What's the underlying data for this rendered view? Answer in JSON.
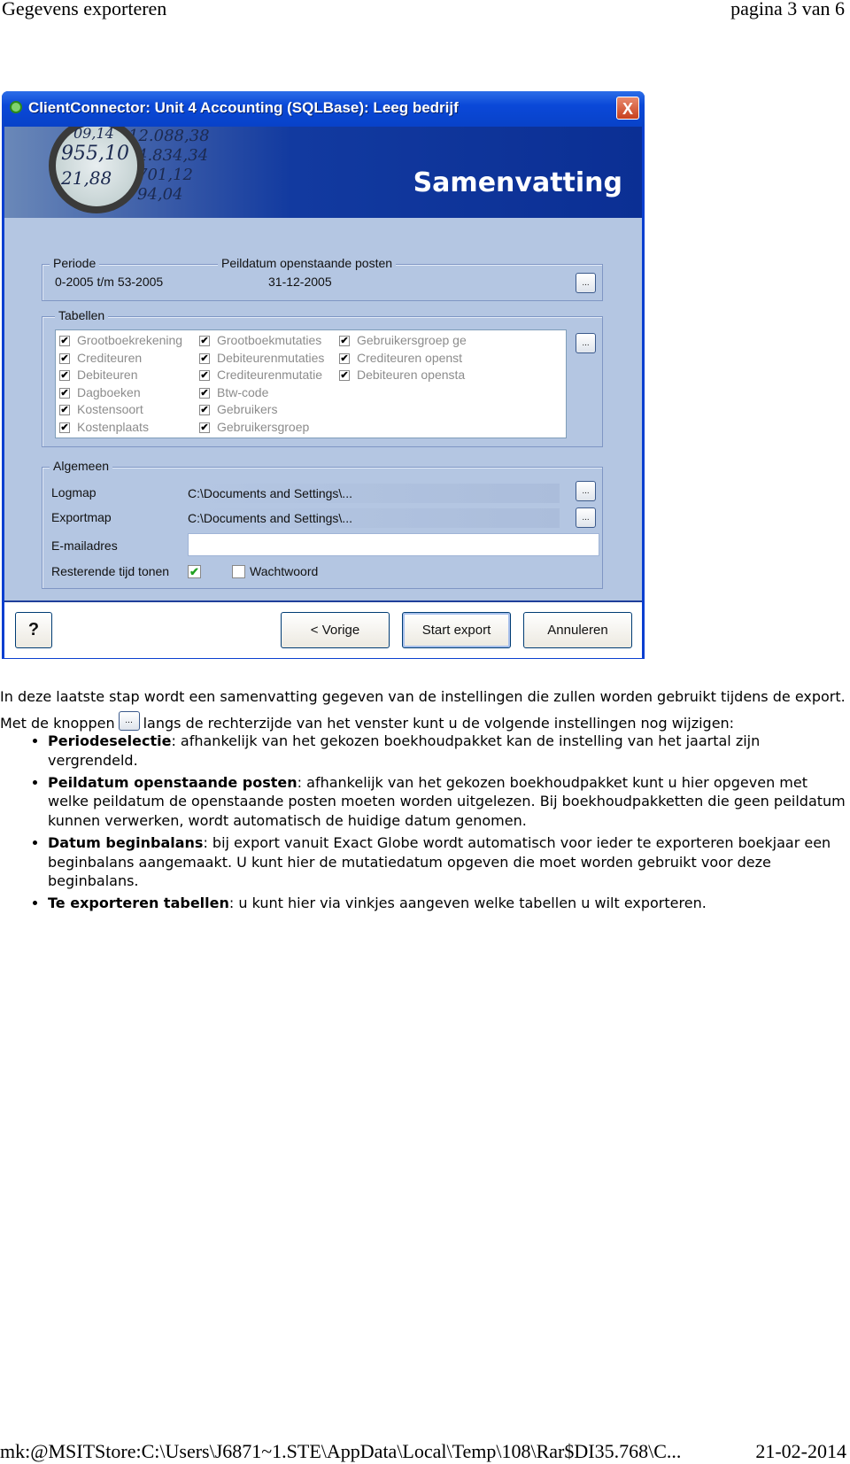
{
  "page_header": {
    "title": "Gegevens exporteren",
    "page": "pagina 3 van 6"
  },
  "window": {
    "title": "ClientConnector: Unit 4 Accounting (SQLBase): Leeg bedrijf",
    "close": "X",
    "banner_title": "Samenvatting",
    "banner_numbers": [
      "12.088,38",
      "955,10",
      "4.834,34",
      "701,12",
      "21,88",
      "94,04",
      "09,14"
    ],
    "periode_group": {
      "label": "Periode",
      "periode_value": "0-2005 t/m 53-2005",
      "peildatum_label": "Peildatum openstaande posten",
      "peildatum_value": "31-12-2005",
      "button": "..."
    },
    "tabellen_group": {
      "label": "Tabellen",
      "button": "...",
      "columns": [
        [
          "Grootboekrekening",
          "Crediteuren",
          "Debiteuren",
          "Dagboeken",
          "Kostensoort",
          "Kostenplaats"
        ],
        [
          "Grootboekmutaties",
          "Debiteurenmutaties",
          "Crediteurenmutatie",
          "Btw-code",
          "Gebruikers",
          "Gebruikersgroep"
        ],
        [
          "Gebruikersgroep ge",
          "Crediteuren openst",
          "Debiteuren opensta"
        ]
      ],
      "all_checked": true
    },
    "algemeen_group": {
      "label": "Algemeen",
      "logmap_label": "Logmap",
      "logmap_value": "C:\\Documents and Settings\\...",
      "exportmap_label": "Exportmap",
      "exportmap_value": "C:\\Documents and Settings\\...",
      "email_label": "E-mailadres",
      "email_value": "",
      "resterende_label": "Resterende tijd tonen",
      "resterende_checked": true,
      "wachtwoord_label": "Wachtwoord",
      "wachtwoord_checked": false,
      "button": "..."
    },
    "footer": {
      "help": "?",
      "prev": "< Vorige",
      "start": "Start export",
      "cancel": "Annuleren"
    }
  },
  "body": {
    "intro_before": "In deze laatste stap wordt een samenvatting gegeven van de instellingen die zullen worden gebruikt tijdens de export. Met de knoppen",
    "intro_button": "...",
    "intro_after": "langs de rechterzijde van het venster kunt u de volgende instellingen nog wijzigen:",
    "bullets": [
      {
        "term": "Periodeselectie",
        "text": ": afhankelijk van het gekozen boekhoudpakket kan de instelling van het jaartal zijn vergrendeld."
      },
      {
        "term": "Peildatum openstaande posten",
        "text": ": afhankelijk van het gekozen boekhoudpakket kunt u hier opgeven met welke peildatum de openstaande posten moeten worden uitgelezen. Bij boekhoudpakketten die geen peildatum kunnen verwerken, wordt automatisch de huidige datum genomen."
      },
      {
        "term": "Datum beginbalans",
        "text": ": bij export vanuit Exact Globe wordt automatisch voor ieder te exporteren boekjaar een beginbalans aangemaakt. U kunt hier de mutatiedatum opgeven die moet worden gebruikt voor deze beginbalans."
      },
      {
        "term": "Te exporteren tabellen",
        "text": ": u kunt hier via vinkjes aangeven welke tabellen u wilt exporteren."
      }
    ]
  },
  "page_footer": {
    "path": "mk:@MSITStore:C:\\Users\\J6871~1.STE\\AppData\\Local\\Temp\\108\\Rar$DI35.768\\C...",
    "date": "21-02-2014"
  }
}
